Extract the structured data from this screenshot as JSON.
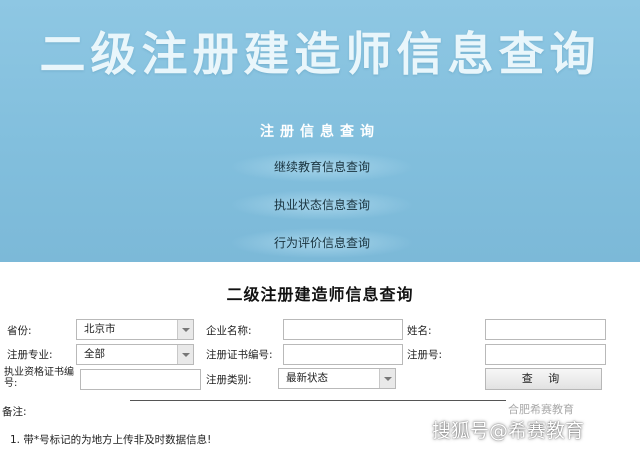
{
  "banner": {
    "title": "二级注册建造师信息查询",
    "menu_header": "注册信息查询",
    "menu_items": [
      "继续教育信息查询",
      "执业状态信息查询",
      "行为评价信息查询"
    ]
  },
  "form": {
    "title": "二级注册建造师信息查询",
    "province": {
      "label": "省份:",
      "value": "北京市"
    },
    "company": {
      "label": "企业名称:",
      "value": ""
    },
    "name": {
      "label": "姓名:",
      "value": ""
    },
    "specialty": {
      "label": "注册专业:",
      "value": "全部"
    },
    "cert_no": {
      "label": "注册证书编号:",
      "value": ""
    },
    "reg_no": {
      "label": "注册号:",
      "value": ""
    },
    "qual_cert": {
      "label": "执业资格证书编号:",
      "value": ""
    },
    "reg_type": {
      "label": "注册类别:",
      "value": "最新状态"
    },
    "search_button": "查 询"
  },
  "notes": {
    "label": "备注:",
    "item1": "1.  带*号标记的为地方上传非及时数据信息!"
  },
  "watermark": {
    "main": "搜狐号@希赛教育",
    "small": "合肥希赛教育"
  },
  "colors": {
    "banner_bg": "#82bfdd",
    "banner_title": "#e9f6fb"
  }
}
